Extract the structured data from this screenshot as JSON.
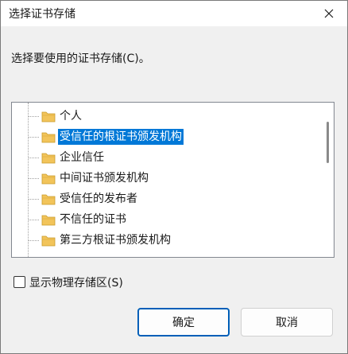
{
  "window": {
    "title": "选择证书存储"
  },
  "prompt": "选择要使用的证书存储(C)。",
  "tree": {
    "items": [
      {
        "label": "个人",
        "selected": false
      },
      {
        "label": "受信任的根证书颁发机构",
        "selected": true
      },
      {
        "label": "企业信任",
        "selected": false
      },
      {
        "label": "中间证书颁发机构",
        "selected": false
      },
      {
        "label": "受信任的发布者",
        "selected": false
      },
      {
        "label": "不信任的证书",
        "selected": false
      },
      {
        "label": "第三方根证书颁发机构",
        "selected": false
      }
    ]
  },
  "show_physical": {
    "label": "显示物理存储区(S)",
    "checked": false
  },
  "buttons": {
    "ok": "确定",
    "cancel": "取消"
  },
  "colors": {
    "selection": "#0078d7",
    "folder": "#f2c45a",
    "primary_border": "#005fb8"
  },
  "icons": {
    "folder": "folder-icon",
    "close": "close-icon"
  }
}
